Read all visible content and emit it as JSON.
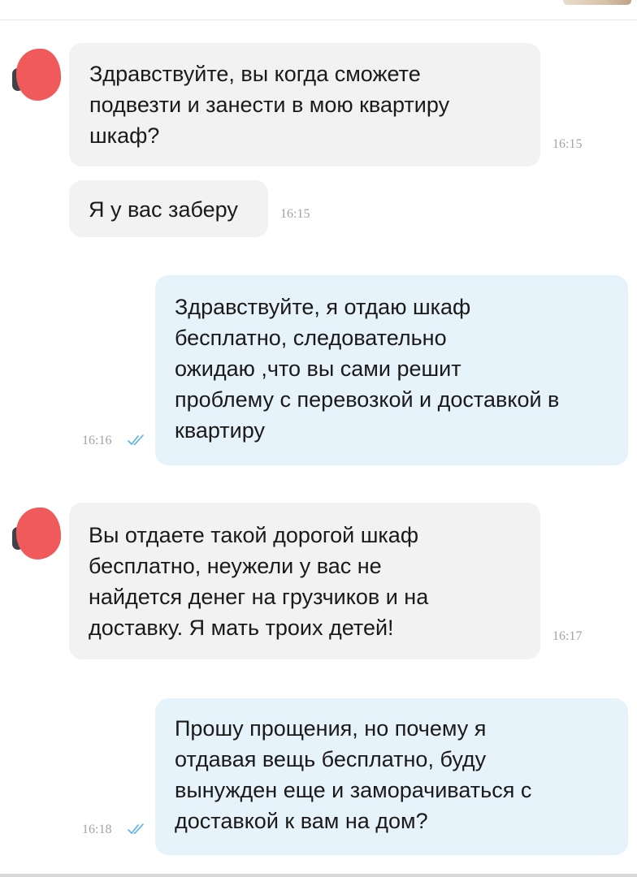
{
  "colors": {
    "incoming_bubble": "#f2f2f3",
    "outgoing_bubble": "#e7f3fb",
    "read_receipt": "#5bb0e6",
    "time": "#a3a3a3",
    "avatar_redaction": "#f05a5a"
  },
  "messages": [
    {
      "direction": "incoming",
      "text": "Здравствуйте, вы когда сможете\nподвезти и занести в мою квартиру\nшкаф?",
      "time": "16:15"
    },
    {
      "direction": "incoming",
      "text": "Я у вас заберу",
      "time": "16:15"
    },
    {
      "direction": "outgoing",
      "text": "Здравствуйте, я отдаю шкаф\nбесплатно, следовательно\nожидаю ,что вы сами решит\nпроблему с перевозкой и доставкой в\nквартиру",
      "time": "16:16",
      "status_icon": "double-check-icon"
    },
    {
      "direction": "incoming",
      "text": "Вы отдаете такой дорогой шкаф\nбесплатно, неужели у вас не\nнайдется денег на грузчиков и на\nдоставку. Я мать троих детей!",
      "time": "16:17"
    },
    {
      "direction": "outgoing",
      "text": "Прошу прощения, но почему я\nотдавая вещь бесплатно, буду\nвынужден еще и заморачиваться с\nдоставкой к вам на дом?",
      "time": "16:18",
      "status_icon": "double-check-icon"
    }
  ]
}
